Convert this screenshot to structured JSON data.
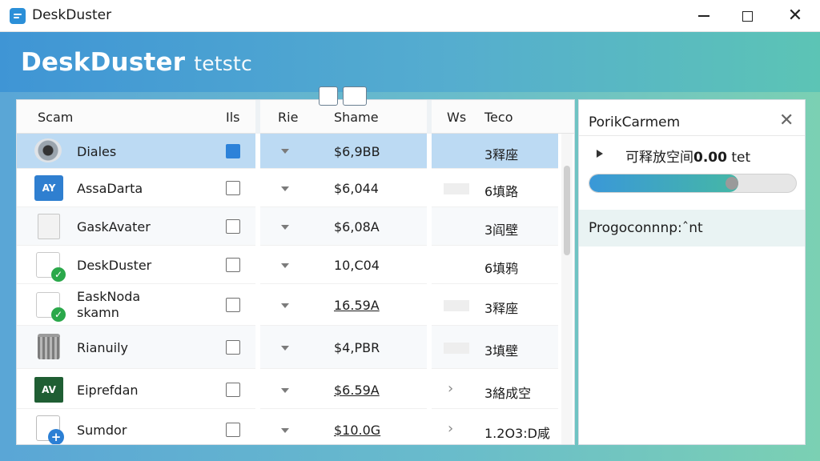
{
  "window": {
    "title": "DeskDuster"
  },
  "banner": {
    "title": "DeskDuster",
    "subtitle": "tetstc"
  },
  "table": {
    "columns": {
      "name": "Scam",
      "check": "Ils",
      "type": "Rie",
      "size": "Shame",
      "w": "Ws",
      "tag": "Teco"
    },
    "rows": [
      {
        "name": "Diales",
        "size": "$6,9BB",
        "tag": "3释座"
      },
      {
        "name": "AssaDarta",
        "size": "$6,044",
        "tag": "6填路"
      },
      {
        "name": "GaskAvater",
        "size": "$6,08A",
        "tag": "3阎壁"
      },
      {
        "name": "DeskDuster",
        "size": "10,C04",
        "tag": "6填鸦"
      },
      {
        "name": "EaskNoda",
        "name_line2": "skamn",
        "size": "16.59A",
        "tag": "3释座"
      },
      {
        "name": "Rianuily",
        "size": "$4,PBR",
        "tag": "3填壁"
      },
      {
        "name": "Eiprefdan",
        "size": "$6.59A",
        "tag": "3絡成空"
      },
      {
        "name": "Sumdor",
        "size": "$10.0G",
        "tag": "1.2O3:D咸"
      }
    ]
  },
  "side": {
    "title": "PorikCarmem",
    "freeable_prefix": "可释放空间",
    "freeable_value": "0.00",
    "freeable_suffix": " tet",
    "progress_fraction": 0.72,
    "section_label": "Progoconnnp:ˆnt"
  }
}
